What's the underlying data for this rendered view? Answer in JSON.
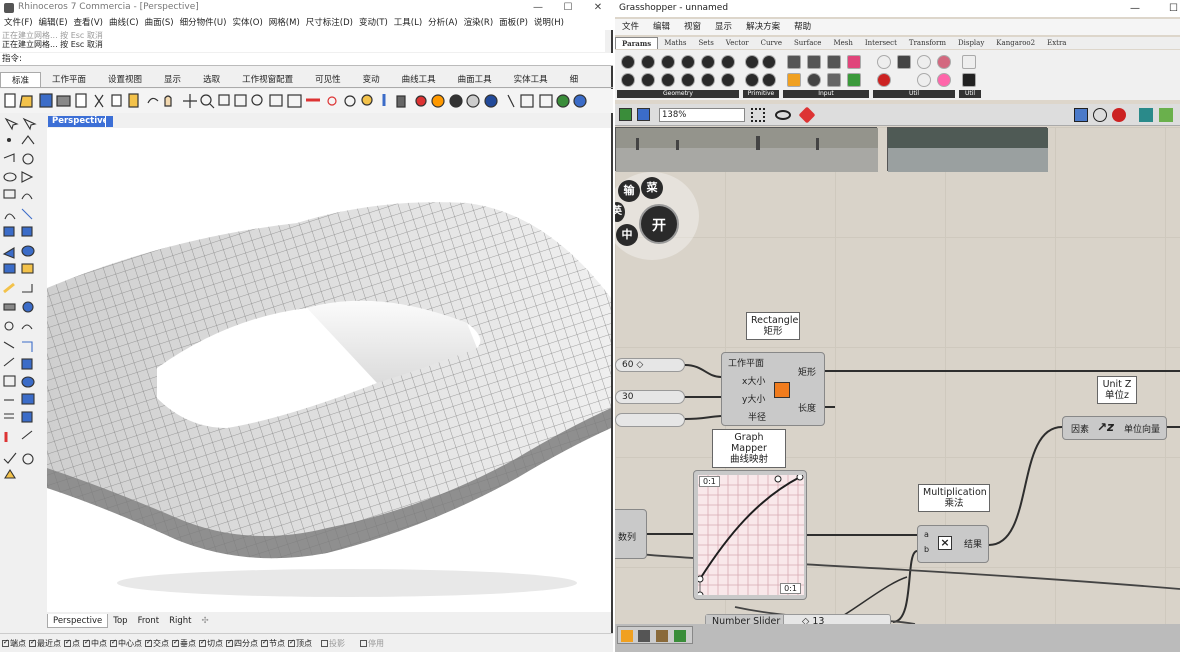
{
  "rhino": {
    "title": "Rhinoceros 7 Commercia - [Perspective]",
    "menu": [
      "文件(F)",
      "编辑(E)",
      "查看(V)",
      "曲线(C)",
      "曲面(S)",
      "细分物件(U)",
      "实体(O)",
      "网格(M)",
      "尺寸标注(D)",
      "变动(T)",
      "工具(L)",
      "分析(A)",
      "渲染(R)",
      "面板(P)",
      "说明(H)"
    ],
    "cmd_history": [
      "正在建立网格... 按 Esc 取消",
      "正在建立网格... 按 Esc 取消"
    ],
    "cmd_prompt": "指令:",
    "tabs": [
      "标准",
      "工作平面",
      "设置视图",
      "显示",
      "选取",
      "工作视窗配置",
      "可见性",
      "变动",
      "曲线工具",
      "曲面工具",
      "实体工具",
      "细"
    ],
    "viewport_label": "Perspective",
    "viewport_tabs": [
      "Perspective",
      "Top",
      "Front",
      "Right",
      "✣"
    ],
    "osnaps": [
      {
        "label": "端点",
        "on": true
      },
      {
        "label": "最近点",
        "on": true
      },
      {
        "label": "点",
        "on": true
      },
      {
        "label": "中点",
        "on": true
      },
      {
        "label": "中心点",
        "on": true
      },
      {
        "label": "交点",
        "on": true
      },
      {
        "label": "垂点",
        "on": true
      },
      {
        "label": "切点",
        "on": true
      },
      {
        "label": "四分点",
        "on": true
      },
      {
        "label": "节点",
        "on": true
      },
      {
        "label": "顶点",
        "on": true
      },
      {
        "label": "投影",
        "on": false
      },
      {
        "label": "停用",
        "on": false
      }
    ]
  },
  "gh": {
    "title": "Grasshopper - unnamed",
    "menu": [
      "文件",
      "编辑",
      "视窗",
      "显示",
      "解决方案",
      "帮助"
    ],
    "tabs": [
      "Params",
      "Maths",
      "Sets",
      "Vector",
      "Curve",
      "Surface",
      "Mesh",
      "Intersect",
      "Transform",
      "Display",
      "Kangaroo2",
      "Extra"
    ],
    "ribbon_groups": [
      "Geometry",
      "Primitive",
      "Input",
      "Util",
      "Util"
    ],
    "zoom": "138%",
    "pie_buttons": [
      "输",
      "菜",
      "英",
      "中",
      "开"
    ],
    "rectangle": {
      "title_en": "Rectangle",
      "title_cn": "矩形",
      "inputs": [
        "工作平面",
        "x大小",
        "y大小",
        "半径"
      ],
      "outputs": [
        "矩形",
        "长度"
      ]
    },
    "graph_mapper": {
      "title_en": "Graph Mapper",
      "title_cn": "曲线映射",
      "top_label": "0:1",
      "bottom_label": "0:1"
    },
    "multiplication": {
      "title_en": "Multiplication",
      "title_cn": "乘法",
      "inputs": [
        "a",
        "b"
      ],
      "output": "结果"
    },
    "unitz": {
      "title_en": "Unit Z",
      "title_cn": "单位z",
      "input": "因素",
      "output": "单位向量"
    },
    "slider_60": "60 ◇",
    "slider_30": "30",
    "series_label": "数列",
    "number_slider": {
      "label": "Number Slider",
      "value": "◇ 13"
    }
  }
}
